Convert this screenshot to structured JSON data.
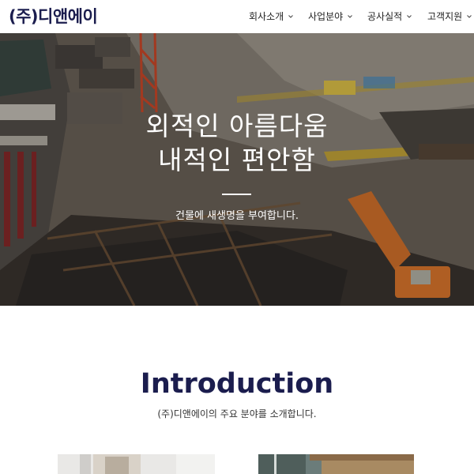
{
  "header": {
    "logo": "(주)디앤에이",
    "nav": [
      {
        "label": "회사소개",
        "icon": "chevron-down-icon"
      },
      {
        "label": "사업분야",
        "icon": "chevron-down-icon"
      },
      {
        "label": "공사실적",
        "icon": "chevron-down-icon"
      },
      {
        "label": "고객지원",
        "icon": "chevron-down-icon"
      }
    ]
  },
  "hero": {
    "title_line1": "외적인 아름다움",
    "title_line2": "내적인 편안함",
    "subtitle": "건물에 새생명을 부여합니다."
  },
  "intro": {
    "title": "Introduction",
    "subtitle": "(주)디앤에이의 주요 분야를 소개합니다."
  },
  "colors": {
    "brand": "#1b1d4e",
    "hero_text": "#ffffff"
  }
}
